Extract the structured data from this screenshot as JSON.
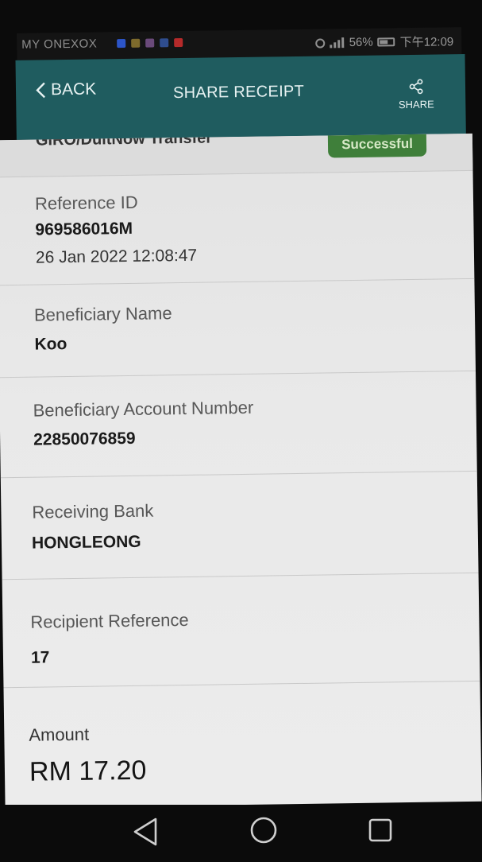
{
  "status_bar": {
    "carrier": "MY ONEXOX",
    "battery": "56%",
    "time": "下午12:09"
  },
  "header": {
    "back_label": "BACK",
    "title": "SHARE RECEIPT",
    "share_label": "SHARE"
  },
  "receipt": {
    "transaction_type": "GIRO/DuitNow Transfer",
    "status": "Successful",
    "reference_label": "Reference ID",
    "reference_id": "969586016M",
    "datetime": "26 Jan 2022 12:08:47",
    "beneficiary_name_label": "Beneficiary Name",
    "beneficiary_name": "Koo",
    "account_number_label": "Beneficiary Account Number",
    "account_number": "22850076859",
    "bank_label": "Receiving Bank",
    "bank": "HONGLEONG",
    "recipient_reference_label": "Recipient Reference",
    "recipient_reference": "17",
    "amount_label": "Amount",
    "amount": "RM 17.20"
  },
  "colors": {
    "header_bg": "#1f5c5f",
    "success_badge": "#3f7f3a"
  },
  "icons": {
    "back": "chevron-left-icon",
    "share": "share-icon",
    "nav_back": "triangle-back-icon",
    "nav_home": "circle-home-icon",
    "nav_recents": "square-recents-icon"
  }
}
